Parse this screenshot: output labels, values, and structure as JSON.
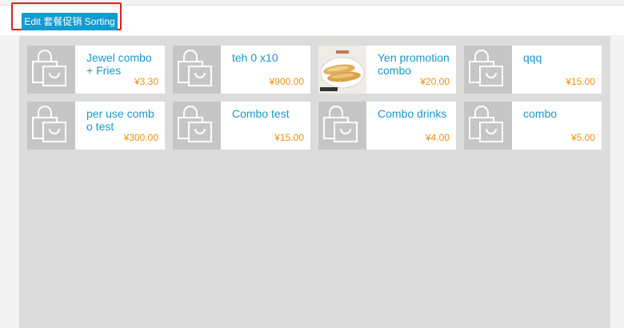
{
  "toolbar": {
    "edit_button_label": "Edit 套餐促销 Sorting"
  },
  "colors": {
    "accent": "#129cd0",
    "name_text": "#1a98c8",
    "price_text": "#f0900a",
    "highlight_border": "#e02020",
    "panel_bg": "#dcdcdc"
  },
  "combos": [
    {
      "name": "Jewel combo + Fries",
      "price": "¥3.30",
      "icon": "shopping-bag-icon"
    },
    {
      "name": "teh 0 x10",
      "price": "¥900.00",
      "icon": "shopping-bag-icon"
    },
    {
      "name": "Yen promotion combo",
      "price": "¥20.00",
      "icon": "bread-photo"
    },
    {
      "name": "qqq",
      "price": "¥15.00",
      "icon": "shopping-bag-icon"
    },
    {
      "name": "per use combo test",
      "price": "¥300.00",
      "icon": "shopping-bag-icon"
    },
    {
      "name": "Combo test",
      "price": "¥15.00",
      "icon": "shopping-bag-icon"
    },
    {
      "name": "Combo drinks",
      "price": "¥4.00",
      "icon": "shopping-bag-icon"
    },
    {
      "name": "combo",
      "price": "¥5.00",
      "icon": "shopping-bag-icon"
    }
  ]
}
